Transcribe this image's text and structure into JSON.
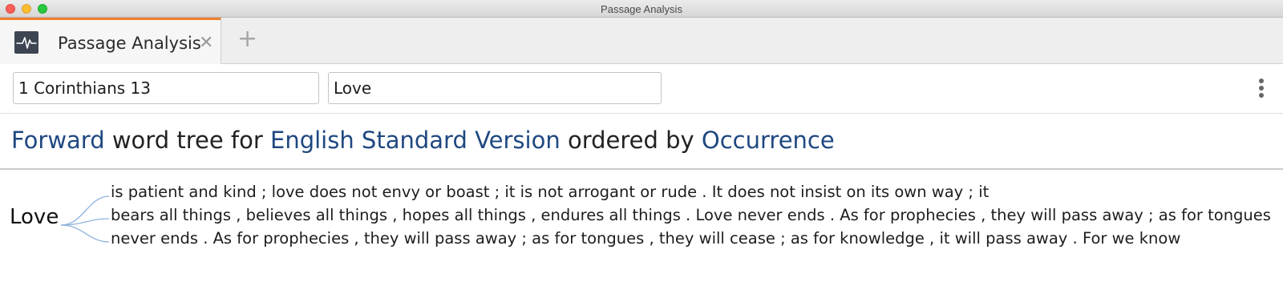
{
  "window": {
    "title": "Passage Analysis"
  },
  "tabs": [
    {
      "label": "Passage Analysis",
      "icon": "waveform-icon",
      "active": true
    }
  ],
  "new_tab_label": "+",
  "tab_close_label": "✕",
  "inputs": {
    "reference": {
      "value": "1 Corinthians 13"
    },
    "word": {
      "value": "Love"
    }
  },
  "heading": {
    "direction": "Forward",
    "text1": "word tree for",
    "version": "English Standard Version",
    "text2": "ordered by",
    "order": "Occurrence"
  },
  "tree": {
    "root": "Love",
    "branches": [
      "is  patient  and  kind ; love  does  not  envy  or  boast ; it  is  not  arrogant  or  rude . It  does  not  insist  on  its  own  way ; it",
      "bears  all  things , believes  all  things , hopes  all  things , endures  all  things .  Love  never  ends . As  for  prophecies , they  will  pass  away ; as  for  tongues",
      "never  ends . As  for  prophecies , they  will  pass  away ; as  for  tongues , they  will  cease ; as  for  knowledge , it  will  pass  away . For  we  know"
    ]
  },
  "colors": {
    "accent_link": "#1f4880",
    "tab_accent": "#f0802c",
    "branch_line": "#8fb3dc"
  }
}
